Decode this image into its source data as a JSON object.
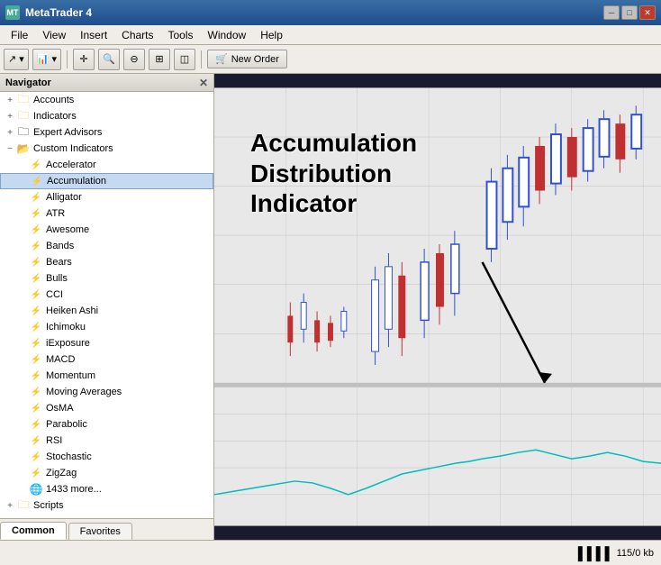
{
  "titlebar": {
    "title": "MetaTrader 4",
    "icon": "MT",
    "controls": [
      "minimize",
      "restore",
      "close"
    ]
  },
  "menubar": {
    "items": [
      "File",
      "View",
      "Insert",
      "Charts",
      "Tools",
      "Window",
      "Help"
    ]
  },
  "toolbar": {
    "new_order_label": "New Order"
  },
  "navigator": {
    "title": "Navigator",
    "tree": [
      {
        "id": "accounts",
        "label": "Accounts",
        "level": 1,
        "toggle": "+",
        "icon": "folder",
        "expanded": false
      },
      {
        "id": "indicators",
        "label": "Indicators",
        "level": 1,
        "toggle": "+",
        "icon": "folder",
        "expanded": false
      },
      {
        "id": "expert-advisors",
        "label": "Expert Advisors",
        "level": 1,
        "toggle": "+",
        "icon": "folder",
        "expanded": false
      },
      {
        "id": "custom-indicators",
        "label": "Custom Indicators",
        "level": 1,
        "toggle": "-",
        "icon": "folder",
        "expanded": true
      },
      {
        "id": "accelerator",
        "label": "Accelerator",
        "level": 2,
        "icon": "item"
      },
      {
        "id": "accumulation",
        "label": "Accumulation",
        "level": 2,
        "icon": "item",
        "selected": true
      },
      {
        "id": "alligator",
        "label": "Alligator",
        "level": 2,
        "icon": "item"
      },
      {
        "id": "atr",
        "label": "ATR",
        "level": 2,
        "icon": "item"
      },
      {
        "id": "awesome",
        "label": "Awesome",
        "level": 2,
        "icon": "item"
      },
      {
        "id": "bands",
        "label": "Bands",
        "level": 2,
        "icon": "item"
      },
      {
        "id": "bears",
        "label": "Bears",
        "level": 2,
        "icon": "item"
      },
      {
        "id": "bulls",
        "label": "Bulls",
        "level": 2,
        "icon": "item"
      },
      {
        "id": "cci",
        "label": "CCI",
        "level": 2,
        "icon": "item"
      },
      {
        "id": "heiken-ashi",
        "label": "Heiken Ashi",
        "level": 2,
        "icon": "item"
      },
      {
        "id": "ichimoku",
        "label": "Ichimoku",
        "level": 2,
        "icon": "item"
      },
      {
        "id": "iexposure",
        "label": "iExposure",
        "level": 2,
        "icon": "item"
      },
      {
        "id": "macd",
        "label": "MACD",
        "level": 2,
        "icon": "item"
      },
      {
        "id": "momentum",
        "label": "Momentum",
        "level": 2,
        "icon": "item"
      },
      {
        "id": "moving-averages",
        "label": "Moving Averages",
        "level": 2,
        "icon": "item"
      },
      {
        "id": "osma",
        "label": "OsMA",
        "level": 2,
        "icon": "item"
      },
      {
        "id": "parabolic",
        "label": "Parabolic",
        "level": 2,
        "icon": "item"
      },
      {
        "id": "rsi",
        "label": "RSI",
        "level": 2,
        "icon": "item"
      },
      {
        "id": "stochastic",
        "label": "Stochastic",
        "level": 2,
        "icon": "item"
      },
      {
        "id": "zigzag",
        "label": "ZigZag",
        "level": 2,
        "icon": "item"
      },
      {
        "id": "more",
        "label": "1433 more...",
        "level": 2,
        "icon": "globe"
      },
      {
        "id": "scripts",
        "label": "Scripts",
        "level": 1,
        "toggle": "+",
        "icon": "folder",
        "expanded": false
      }
    ],
    "tabs": [
      "Common",
      "Favorites"
    ]
  },
  "annotation": {
    "line1": "Accumulation",
    "line2": "Distribution",
    "line3": "Indicator"
  },
  "statusbar": {
    "memory": "115/0 kb"
  },
  "colors": {
    "chart_bg": "#1a1a2e",
    "bullish": "#3050d0",
    "bearish": "#c03030",
    "indicator_line": "#00cccc",
    "annotation_text": "#000000"
  }
}
